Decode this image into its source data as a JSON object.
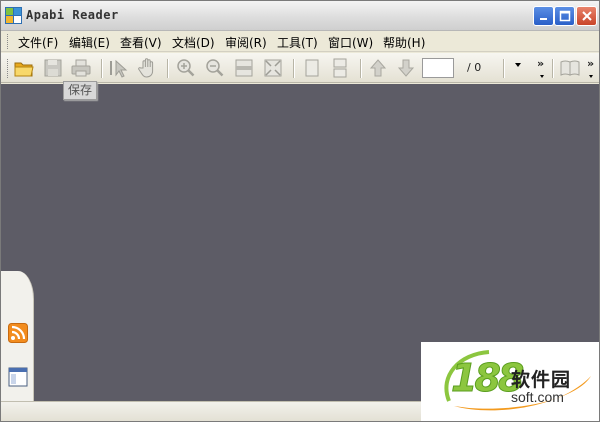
{
  "window": {
    "title": "Apabi Reader",
    "icons": {
      "app": "apabi-app-icon",
      "minimize": "minimize-icon",
      "maximize": "maximize-icon",
      "close": "close-icon"
    }
  },
  "menu": {
    "items": [
      {
        "label": "文件(F)"
      },
      {
        "label": "编辑(E)"
      },
      {
        "label": "查看(V)"
      },
      {
        "label": "文档(D)"
      },
      {
        "label": "审阅(R)"
      },
      {
        "label": "工具(T)"
      },
      {
        "label": "窗口(W)"
      },
      {
        "label": "帮助(H)"
      }
    ]
  },
  "toolbar": {
    "tooltip": "保存",
    "page_input_value": "",
    "page_total": "/ 0",
    "overflow_label": "»",
    "buttons": [
      "open-folder-icon",
      "save-icon",
      "print-icon",
      "select-text-icon",
      "hand-tool-icon",
      "zoom-in-icon",
      "zoom-out-icon",
      "fit-width-icon",
      "fit-page-icon",
      "single-page-icon",
      "continuous-page-icon",
      "prev-page-icon",
      "next-page-icon",
      "book-view-icon"
    ]
  },
  "sidepanel": {
    "icons": [
      "rss-icon",
      "panel-layout-icon"
    ]
  },
  "watermark": {
    "number": "188",
    "cn": "软件园",
    "en": "soft.com"
  },
  "colors": {
    "workarea": "#5d5c66",
    "chrome": "#ece9d8",
    "accent_folder": "#f5c542",
    "rss": "#f28c1e",
    "watermark_green": "#8cc63f",
    "watermark_orange": "#f39a1e"
  }
}
